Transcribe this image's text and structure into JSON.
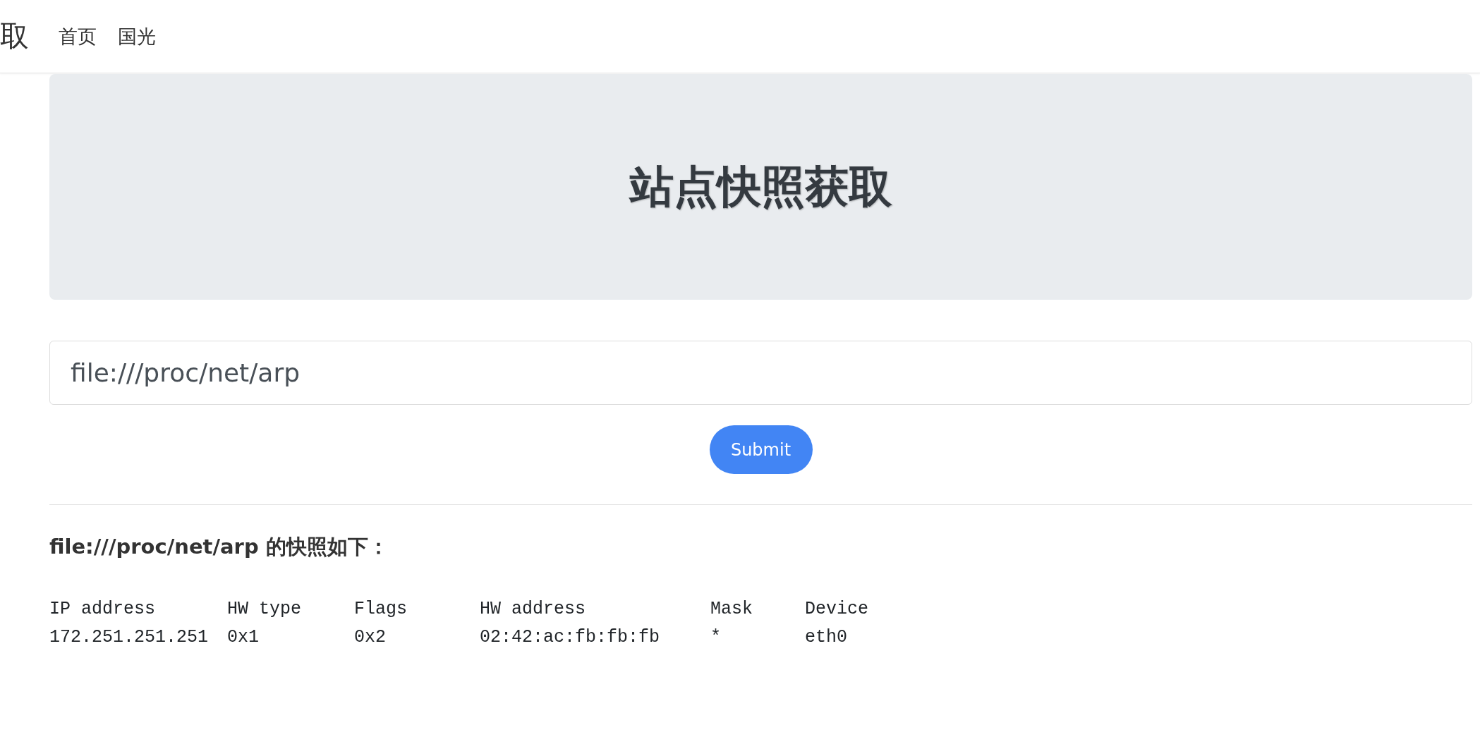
{
  "navbar": {
    "brand": "取",
    "links": [
      {
        "label": "首页"
      },
      {
        "label": "国光"
      }
    ]
  },
  "jumbotron": {
    "title": "站点快照获取"
  },
  "form": {
    "url_field": {
      "value": "file:///proc/net/arp"
    },
    "submit": "Submit"
  },
  "result": {
    "heading": "file:///proc/net/arp 的快照如下：",
    "columns": [
      "IP address",
      "HW type",
      "Flags",
      "HW address",
      "Mask",
      "Device"
    ],
    "rows": [
      [
        "172.251.251.251",
        "0x1",
        "0x2",
        "02:42:ac:fb:fb:fb",
        "*",
        "eth0"
      ]
    ]
  }
}
